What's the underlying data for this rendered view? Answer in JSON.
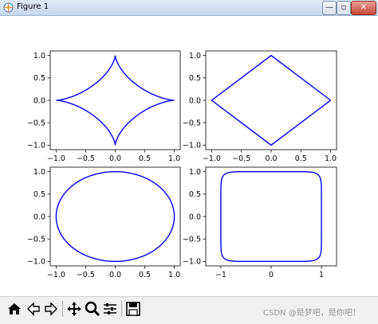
{
  "window": {
    "title": "Figure 1",
    "minimize": "—",
    "maximize": "▫",
    "close": "✕"
  },
  "toolbar": {
    "icons": [
      "home-icon",
      "back-icon",
      "forward-icon",
      "pan-icon",
      "zoom-icon",
      "subplots-icon",
      "save-icon"
    ]
  },
  "watermark": "CSDN @是梦吧，是你吧！",
  "colors": {
    "line": "#0000ff",
    "axes": "#000000"
  },
  "chart_data": [
    {
      "type": "line",
      "curve": "astroid",
      "parametric": "x=cos^3 t, y=sin^3 t",
      "xlim": [
        -1.1,
        1.1
      ],
      "ylim": [
        -1.1,
        1.1
      ],
      "xticks": [
        "−1.0",
        "−0.5",
        "0.0",
        "0.5",
        "1.0"
      ],
      "yticks": [
        "1.0",
        "0.5",
        "0.0",
        "−0.5",
        "−1.0"
      ]
    },
    {
      "type": "line",
      "curve": "diamond",
      "x": [
        1,
        0,
        -1,
        0,
        1
      ],
      "y": [
        0,
        1,
        0,
        -1,
        0
      ],
      "xlim": [
        -1.1,
        1.1
      ],
      "ylim": [
        -1.1,
        1.1
      ],
      "xticks": [
        "−1.0",
        "−0.5",
        "0.0",
        "0.5",
        "1.0"
      ],
      "yticks": [
        "1.0",
        "0.5",
        "0.0",
        "−0.5",
        "−1.0"
      ]
    },
    {
      "type": "line",
      "curve": "circle",
      "parametric": "x=cos t, y=sin t",
      "xlim": [
        -1.1,
        1.1
      ],
      "ylim": [
        -1.1,
        1.1
      ],
      "xticks": [
        "−1.0",
        "−0.5",
        "0.0",
        "0.5",
        "1.0"
      ],
      "yticks": [
        "1.0",
        "0.5",
        "0.0",
        "−0.5",
        "−1.0"
      ]
    },
    {
      "type": "line",
      "curve": "squircle",
      "parametric": "x=cos^(2/10) t, y=sin^(2/10) t",
      "xlim": [
        -1.3,
        1.3
      ],
      "ylim": [
        -1.1,
        1.1
      ],
      "xticks": [
        "−1",
        "0",
        "1"
      ],
      "yticks": [
        "1.0",
        "0.5",
        "0.0",
        "−0.5",
        "−1.0"
      ]
    }
  ]
}
